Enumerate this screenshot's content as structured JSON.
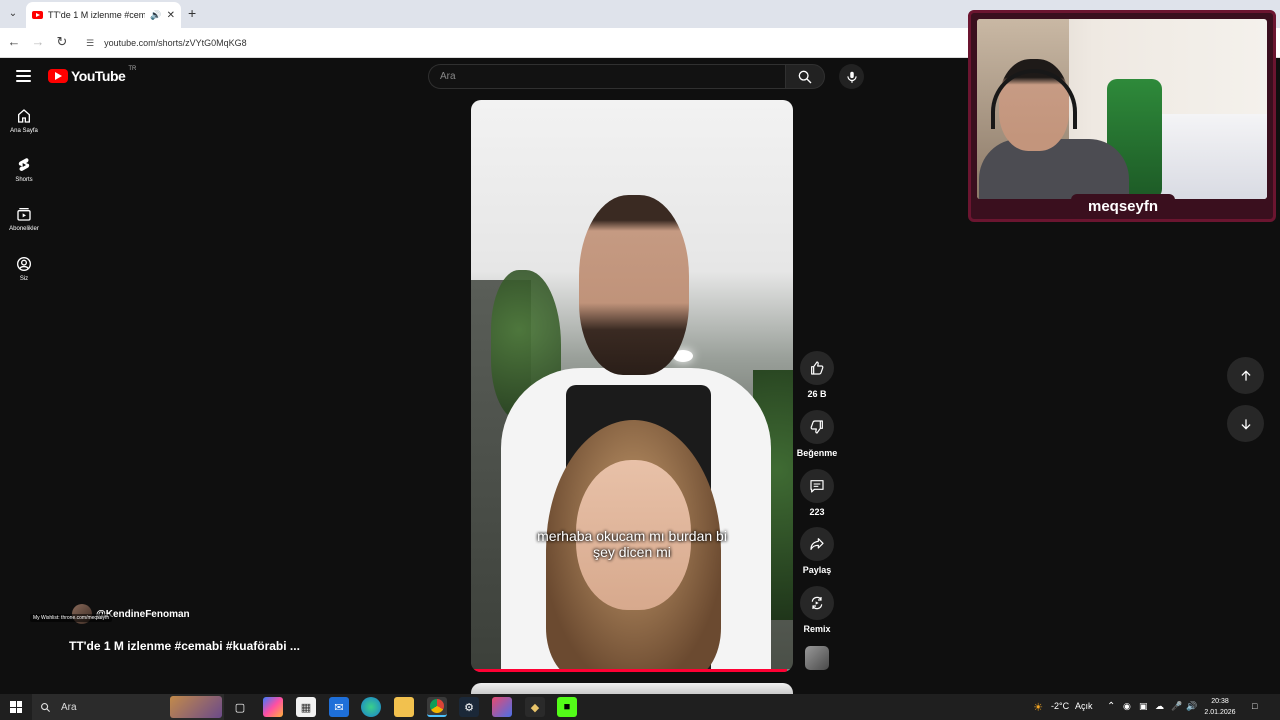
{
  "browser": {
    "tab_title": "TT'de 1 M izlenme #cemab",
    "url": "youtube.com/shorts/zVYtG0MqKG8",
    "new_tab_symbol": "+"
  },
  "youtube": {
    "logo_text": "YouTube",
    "country_code": "TR",
    "search_placeholder": "Ara"
  },
  "sidebar": {
    "items": [
      {
        "label": "Ana Sayfa",
        "icon": "home-icon"
      },
      {
        "label": "Shorts",
        "icon": "shorts-icon"
      },
      {
        "label": "Abonelikler",
        "icon": "subscriptions-icon"
      },
      {
        "label": "Siz",
        "icon": "you-icon"
      }
    ]
  },
  "video": {
    "caption_line1": "merhaba okucam mı burdan bi",
    "caption_line2": "şey dicen mi",
    "progress": 0.98
  },
  "actions": {
    "like_count": "26 B",
    "dislike_label": "Beğenme",
    "comment_count": "223",
    "share_label": "Paylaş",
    "remix_label": "Remix"
  },
  "info": {
    "channel_handle": "@KendineFenoman",
    "wishlist_text": "My Wishlist: throne.com/meqseyfn",
    "title": "TT'de 1 M izlenme  #cemabi #kuaförabi ..."
  },
  "webcam": {
    "name": "meqseyfn"
  },
  "taskbar": {
    "search_text": "Ara",
    "weather": "-2°C",
    "weather_desc": "Açık",
    "time": "20:38",
    "date": "2.01.2026"
  },
  "colors": {
    "accent_red": "#ff0033",
    "overlay_frame": "#6b1530"
  }
}
